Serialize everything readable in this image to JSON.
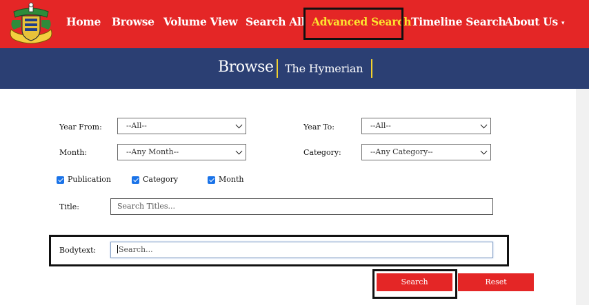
{
  "nav": {
    "items": [
      "Home",
      "Browse",
      "Volume View",
      "Search All",
      "Advanced Search",
      "Timeline Search",
      "About Us"
    ],
    "active_index": 4,
    "about_caret": "▾"
  },
  "banner": {
    "title": "Browse",
    "subtitle": "The Hymerian"
  },
  "form": {
    "year_from_label": "Year From:",
    "year_from_value": "--All--",
    "year_to_label": "Year To:",
    "year_to_value": "--All--",
    "month_label": "Month:",
    "month_value": "--Any Month--",
    "category_label": "Category:",
    "category_value": "--Any Category--",
    "checkboxes": [
      {
        "label": "Publication",
        "checked": true
      },
      {
        "label": "Category",
        "checked": true
      },
      {
        "label": "Month",
        "checked": true
      }
    ],
    "title_label": "Title:",
    "title_placeholder": "Search Titles...",
    "bodytext_label": "Bodytext:",
    "bodytext_placeholder": "Search..."
  },
  "buttons": {
    "search": "Search",
    "reset": "Reset"
  },
  "colors": {
    "nav_red": "#e42626",
    "banner_blue": "#2b3f73",
    "accent_yellow": "#fde32e",
    "checkbox_blue": "#1a73e8"
  }
}
